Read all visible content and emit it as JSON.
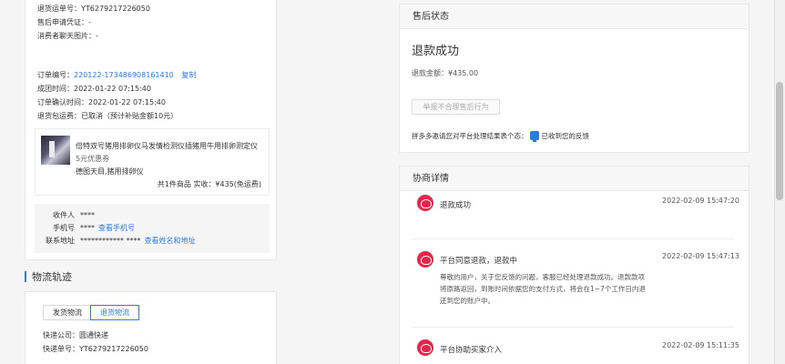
{
  "order_info": {
    "return_tracking": "退货运单号：YT6279217226050",
    "after_sale_proof": "售后申请凭证：-",
    "consumer_chat_image": "消费者聊天图片：-",
    "order_no_label": "订单编号：",
    "order_no": "220122-173486908161410",
    "copy": "复制",
    "group_time": "成团时间：2022-01-22 07:15:40",
    "confirm_time": "订单确认时间：2022-01-22 07:15:40",
    "return_shipping": "退货包运费：已取消（预计补贴金额10元）"
  },
  "product": {
    "name": "倍特双号猪用排卵仪马发情检测仪插猪用牛用排卵测定仪",
    "coupon": "5元优惠券",
    "spec": "德图天目,猪用排卵仪",
    "total": "共1件商品   实收：¥435(免运费)"
  },
  "address": {
    "recipient_label": "收件人",
    "recipient": "****",
    "phone_label": "手机号",
    "phone": "****",
    "view_phone": "查看手机号",
    "addr_label": "联系地址",
    "addr": "************ ****",
    "view_addr": "查看姓名和地址"
  },
  "logistics": {
    "title": "物流轨迹",
    "tab_send": "发货物流",
    "tab_return": "退货物流",
    "company": "快递公司：圆通快递",
    "tracking": "快递单号：YT6279217226050"
  },
  "after_sale": {
    "header": "售后状态",
    "status": "退款成功",
    "amount": "退款金额：¥435.00",
    "report_btn": "举报不合理售后行为",
    "satisfaction_q": "拼多多邀请您对平台处理结果表个态：",
    "satisfaction_a": "已收到您的反馈"
  },
  "negotiation": {
    "header": "协商详情",
    "items": [
      {
        "title": "退款成功",
        "time": "2022-02-09 15:47:20",
        "desc": ""
      },
      {
        "title": "平台同意退款，退款中",
        "time": "2022-02-09 15:47:13",
        "desc": "尊敬的用户，关于您反馈的问题，客服已经处理退款成功。退款款项将原路返回，到账时间依据您的支付方式，将会在1~7个工作日内退还到您的账户中。"
      },
      {
        "title": "平台协助买家介入",
        "time": "2022-02-09 15:11:35",
        "desc": ""
      }
    ]
  }
}
